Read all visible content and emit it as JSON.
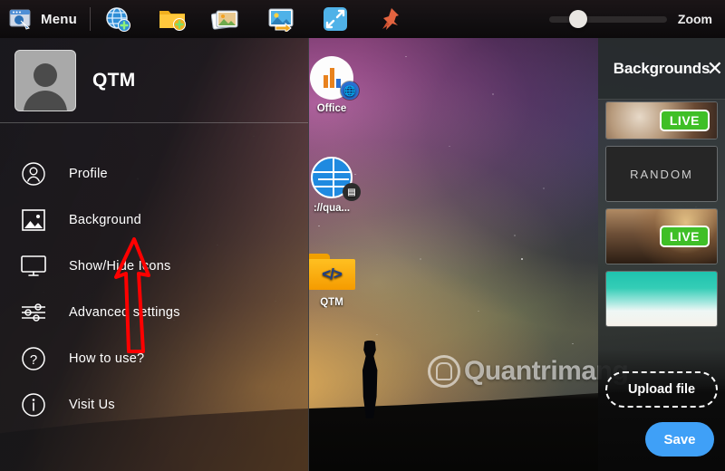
{
  "toolbar": {
    "menu_label": "Menu",
    "menu_icon": "app-window-cursor-icon",
    "buttons": [
      {
        "name": "add-web-shortcut",
        "icon": "globe-plus-icon"
      },
      {
        "name": "add-folder",
        "icon": "folder-plus-icon"
      },
      {
        "name": "photo-stack",
        "icon": "photos-icon"
      },
      {
        "name": "change-image",
        "icon": "image-swap-icon"
      },
      {
        "name": "resize",
        "icon": "expand-arrows-icon"
      },
      {
        "name": "pin",
        "icon": "pushpin-icon"
      }
    ],
    "zoom_label": "Zoom",
    "zoom_value": 25
  },
  "sidebar": {
    "profile": {
      "name": "QTM",
      "avatar_icon": "user-avatar-placeholder"
    },
    "items": [
      {
        "label": "Profile",
        "icon": "user-circle-icon"
      },
      {
        "label": "Background",
        "icon": "image-icon"
      },
      {
        "label": "Show/Hide Icons",
        "icon": "monitor-icon"
      },
      {
        "label": "Advanced settings",
        "icon": "sliders-icon"
      },
      {
        "label": "How to use?",
        "icon": "question-circle-icon"
      },
      {
        "label": "Visit Us",
        "icon": "info-circle-icon"
      }
    ],
    "annotation": {
      "type": "red-arrow",
      "points_to": "Background",
      "color": "#ff0000"
    }
  },
  "desktop": {
    "icons": [
      {
        "label": "Office",
        "icon": "office-shortcut-icon"
      },
      {
        "label": "://qua...",
        "icon": "globe-shortcut-icon"
      },
      {
        "label": "QTM",
        "icon": "code-folder-icon",
        "glyph": "</>"
      }
    ],
    "watermark": "Quantrimang",
    "watermark_logo": "lightbulb-circle-icon"
  },
  "backgrounds_panel": {
    "title": "Backgrounds",
    "close_icon": "close-icon",
    "thumbnails": [
      {
        "name": "coffee-flatlay",
        "badge": "LIVE",
        "style": "coffee"
      },
      {
        "name": "random",
        "label": "RANDOM",
        "badge": "",
        "style": "random"
      },
      {
        "name": "restaurant-interior",
        "badge": "LIVE",
        "style": "restaurant"
      },
      {
        "name": "beach-waves",
        "badge": "",
        "style": "beach"
      }
    ],
    "upload_label": "Upload file",
    "save_label": "Save",
    "save_color": "#3fa0f7",
    "live_badge_color": "#3fbf27"
  }
}
